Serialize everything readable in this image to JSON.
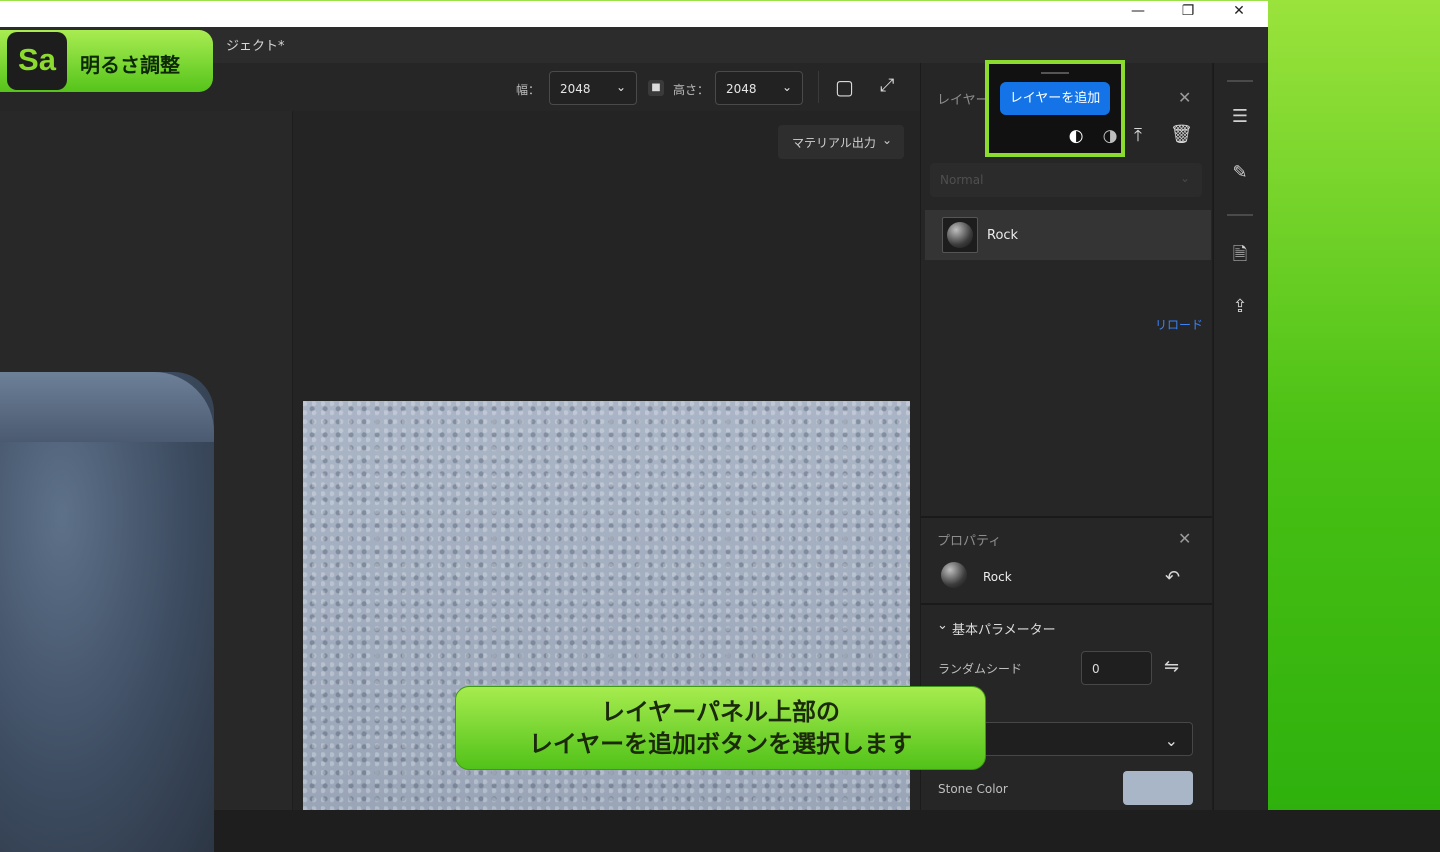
{
  "titlebar": {
    "minimize_icon": "minimize-icon",
    "restore_icon": "restore-icon",
    "close_icon": "close-icon"
  },
  "menubar": {
    "project_title": "ジェクト*"
  },
  "toolbar": {
    "width_label": "幅：",
    "width_value": "2048",
    "height_label": "高さ：",
    "height_value": "2048"
  },
  "viewport": {
    "material_output": "マテリアル出力"
  },
  "layers_panel": {
    "title": "レイヤー",
    "blend_mode": "Normal",
    "layer_name": "Rock",
    "reload": "リロード"
  },
  "popup": {
    "add_layer_button": "レイヤーを追加"
  },
  "properties_panel": {
    "title": "プロパティ",
    "item_name": "Rock",
    "section": "基本パラメーター",
    "random_seed_label": "ランダムシード",
    "random_seed_value": "0",
    "stone_color_label": "Stone Color",
    "stone_color_hex": "#a9b6c7"
  },
  "overlay": {
    "badge_logo": "Sa",
    "badge_text": "明るさ調整",
    "caption_line1": "レイヤーパネル上部の",
    "caption_line2": "レイヤーを追加ボタンを選択します"
  },
  "colors": {
    "accent_blue": "#1473e6",
    "highlight_green": "#8bdc2f"
  }
}
